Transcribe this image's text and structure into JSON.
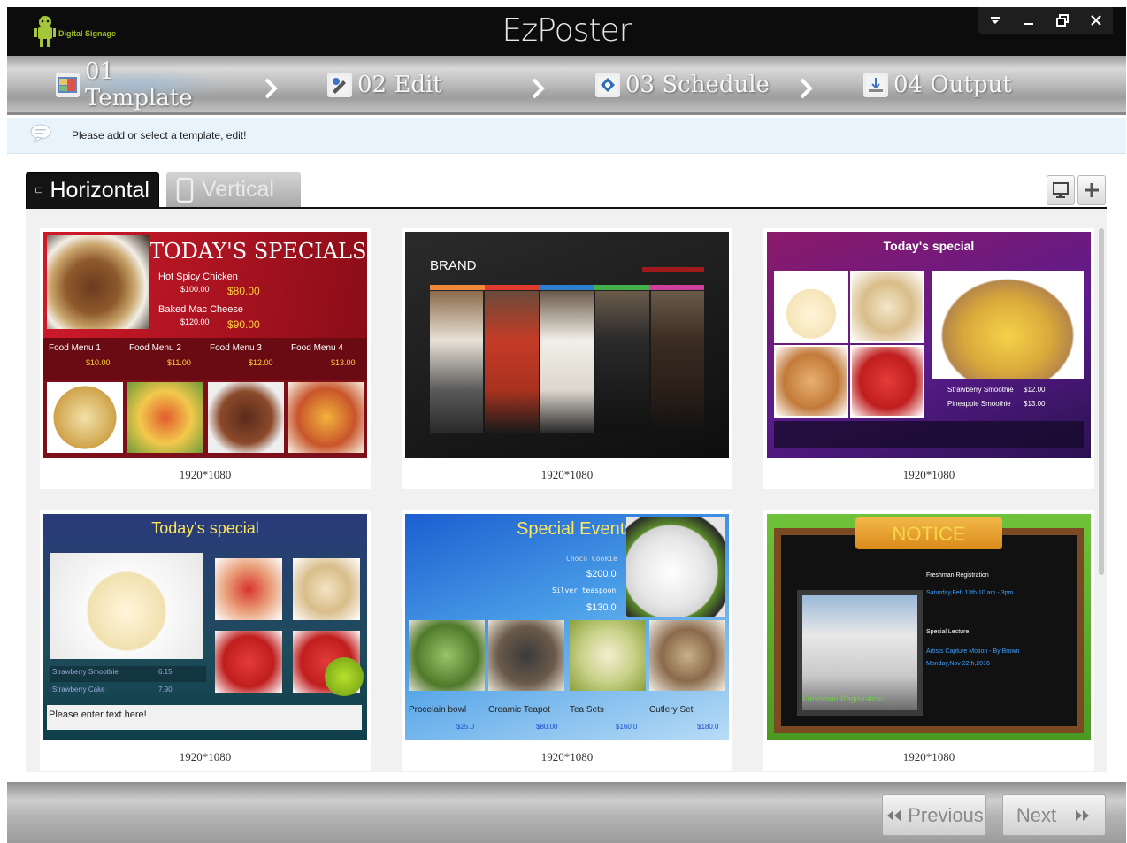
{
  "app": {
    "title": "EzPoster",
    "logo_text": "Digital Signage",
    "brand_color": "#9fbf22"
  },
  "window_controls": [
    {
      "name": "menu",
      "icon": "dropdown-icon"
    },
    {
      "name": "minimize",
      "icon": "minimize-icon"
    },
    {
      "name": "restore",
      "icon": "restore-icon"
    },
    {
      "name": "close",
      "icon": "close-icon"
    }
  ],
  "steps": [
    {
      "label": "01 Template",
      "icon": "template-icon",
      "active": true
    },
    {
      "label": "02 Edit",
      "icon": "edit-icon",
      "active": false
    },
    {
      "label": "03 Schedule",
      "icon": "schedule-icon",
      "active": false
    },
    {
      "label": "04 Output",
      "icon": "output-icon",
      "active": false
    }
  ],
  "hint": {
    "text": "Please add or select a template, edit!"
  },
  "tabs": {
    "horizontal": "Horizontal",
    "vertical": "Vertical",
    "selected": "Horizontal"
  },
  "templates": [
    {
      "resolution": "1920*1080",
      "heading": "TODAY'S SPECIALS",
      "items": [
        {
          "name": "Hot Spicy Chicken",
          "old_price": "$100.00",
          "price": "$80.00"
        },
        {
          "name": "Baked Mac Cheese",
          "old_price": "$120.00",
          "price": "$90.00"
        }
      ],
      "menus": [
        {
          "name": "Food Menu 1",
          "price": "$10.00"
        },
        {
          "name": "Food Menu 2",
          "price": "$11.00"
        },
        {
          "name": "Food Menu 3",
          "price": "$12.00"
        },
        {
          "name": "Food Menu 4",
          "price": "$13.00"
        }
      ]
    },
    {
      "resolution": "1920*1080",
      "heading": "BRAND"
    },
    {
      "resolution": "1920*1080",
      "heading": "Today's special",
      "items": [
        {
          "name": "Strawberry Smoothie",
          "price": "$12.00"
        },
        {
          "name": "Pineapple Smoothie",
          "price": "$13.00"
        }
      ]
    },
    {
      "resolution": "1920*1080",
      "heading": "Today's special",
      "items": [
        {
          "name": "Strawberry Smoothie",
          "price": "6.15"
        },
        {
          "name": "Strawberry Cake",
          "price": "7.90"
        }
      ],
      "placeholder": "Please enter text here!"
    },
    {
      "resolution": "1920*1080",
      "heading": "Special Events",
      "items": [
        {
          "name": "Choco Cookie",
          "price": "$200.0"
        },
        {
          "name": "Silver teaspoon",
          "price": "$130.0"
        }
      ],
      "products": [
        {
          "name": "Procelain bowl",
          "price": "$25.0"
        },
        {
          "name": "Creamic Teapot",
          "price": "$80.00"
        },
        {
          "name": "Tea Sets",
          "price": "$160.0"
        },
        {
          "name": "Cutlery Set",
          "price": "$180.0"
        }
      ]
    },
    {
      "resolution": "1920*1080",
      "heading": "NOTICE",
      "lines": [
        "Freshman Registration",
        "Saturday,Feb 13th,10 am - 3pm",
        "Special Lecture",
        "Artists Capture Motion - By Brown",
        "Monday,Nov 22th,2016"
      ],
      "photo_caption": "Freshman Registration"
    }
  ],
  "nav": {
    "previous": "Previous",
    "next": "Next"
  }
}
